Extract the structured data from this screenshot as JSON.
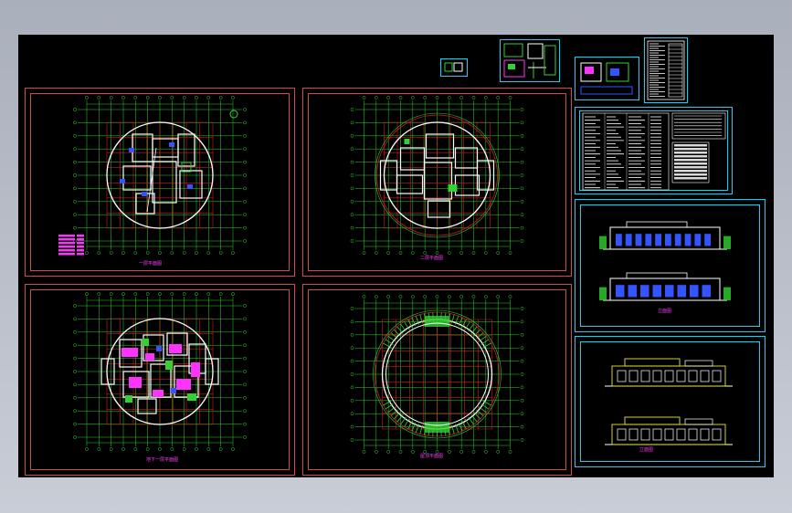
{
  "viewer": {
    "colors": {
      "background": "#000000",
      "frame": "#c9cdd6",
      "sheet_border": "#d24a4a",
      "cyan_border": "#00d8ff",
      "axis_green": "#32d232",
      "grid_red": "#c81e1e",
      "wall_white": "#ffffff",
      "magenta": "#ff33ff",
      "blue": "#3355ff",
      "yellow": "#e6e632"
    }
  },
  "sheets": [
    {
      "id": "plan-1",
      "icon": "floor-plan-drawing",
      "label": "一层平面图"
    },
    {
      "id": "plan-2",
      "icon": "floor-plan-drawing",
      "label": "二层平面图"
    },
    {
      "id": "plan-3",
      "icon": "floor-plan-drawing",
      "label": "地下一层平面图"
    },
    {
      "id": "plan-4",
      "icon": "roof-plan-drawing",
      "label": "屋顶平面图"
    },
    {
      "id": "elev-1",
      "icon": "elevation-drawing",
      "label": "立面图"
    },
    {
      "id": "elev-2",
      "icon": "elevation-drawing",
      "label": "立面图"
    },
    {
      "id": "notes",
      "icon": "design-notes-table",
      "label": "设计说明"
    }
  ]
}
